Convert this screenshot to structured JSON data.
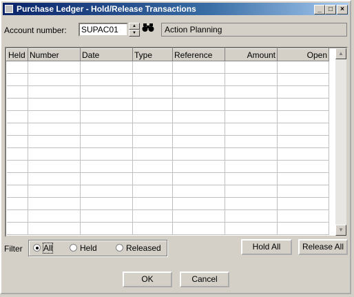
{
  "window": {
    "title": "Purchase Ledger - Hold/Release Transactions",
    "controls": {
      "minimize": "_",
      "maximize": "□",
      "close": "×"
    }
  },
  "account": {
    "label": "Account number:",
    "value": "SUPAC01",
    "name": "Action Planning"
  },
  "grid": {
    "columns": [
      "Held",
      "Number",
      "Date",
      "Type",
      "Reference",
      "Amount",
      "Open"
    ],
    "rows": []
  },
  "filter": {
    "label": "Filter",
    "options": [
      "All",
      "Held",
      "Released"
    ],
    "selected": "All"
  },
  "buttons": {
    "hold_all": "Hold All",
    "release_all": "Release All",
    "ok": "OK",
    "cancel": "Cancel"
  },
  "icons": {
    "find": "binoculars-icon",
    "spin_up": "up-arrow-icon",
    "spin_down": "down-arrow-icon"
  }
}
